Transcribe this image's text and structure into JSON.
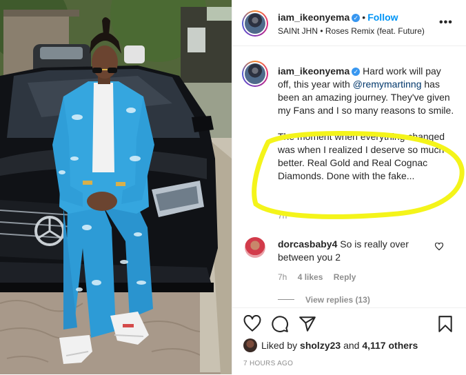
{
  "header": {
    "username": "iam_ikeonyema",
    "separator": "•",
    "follow_label": "Follow",
    "song": "SAINt JHN • Roses Remix (feat. Future)",
    "more_icon": "more-options-icon",
    "more_label": "•••"
  },
  "caption": {
    "username": "iam_ikeonyema",
    "text_before_mention": " Hard work will pay off, this year with ",
    "mention": "@remymartinng",
    "text_after_mention": " has been an amazing journey. They've given my Fans and I so many reasons to smile.",
    "paragraph2": "The moment when everything changed was when I realized I deserve so much better. Real Gold and Real Cognac Diamonds. Done with the fake...",
    "time": "7h"
  },
  "comment": {
    "username": "dorcasbaby4",
    "text": " So is really over between you 2",
    "time": "7h",
    "likes": "4 likes",
    "reply_label": "Reply",
    "view_replies": "View replies (13)"
  },
  "actions": {
    "icons": [
      "heart-icon",
      "comment-icon",
      "share-icon",
      "bookmark-icon"
    ]
  },
  "likes": {
    "prefix": "Liked by ",
    "user": "sholzy23",
    "middle": " and ",
    "count": "4,117 others"
  },
  "timestamp": "7 HOURS AGO",
  "colors": {
    "accent_blue": "#0095f6",
    "verified_blue": "#3897f0",
    "highlight_yellow": "#f4f41a",
    "mention": "#00376b",
    "muted": "#8e8e8e"
  }
}
